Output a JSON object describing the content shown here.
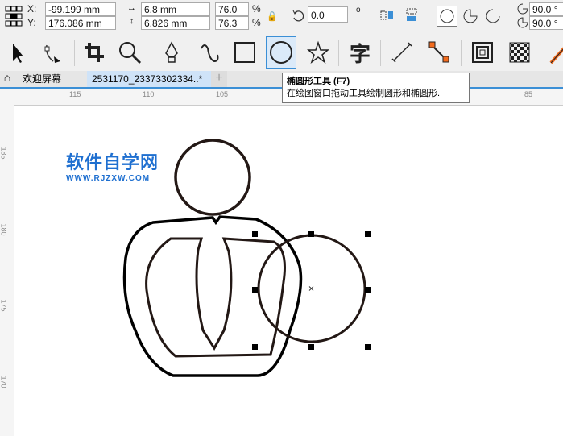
{
  "property_bar": {
    "x_label": "X:",
    "x_value": "-99.199 mm",
    "y_label": "Y:",
    "y_value": "176.086 mm",
    "width_value": "6.8 mm",
    "height_value": "6.826 mm",
    "scale_x": "76.0",
    "scale_y": "76.3",
    "percent": "%",
    "rotation": "0.0",
    "degree": "o",
    "start_angle": "90.0 °",
    "end_angle": "90.0 °"
  },
  "tabs": [
    {
      "label": "欢迎屏幕"
    },
    {
      "label": "2531170_23373302334..*"
    }
  ],
  "tab_add": "+",
  "tooltip": {
    "title": "椭圆形工具 (F7)",
    "body": "在绘图窗口拖动工具绘制圆形和椭圆形."
  },
  "ruler_top": [
    "115",
    "110",
    "105",
    "85"
  ],
  "ruler_left": [
    "185",
    "180",
    "175",
    "170"
  ],
  "watermark": {
    "title": "软件自学网",
    "url": "WWW.RJZXW.COM",
    "color": "#1e6fd0"
  },
  "accent": "#3b8fd6"
}
